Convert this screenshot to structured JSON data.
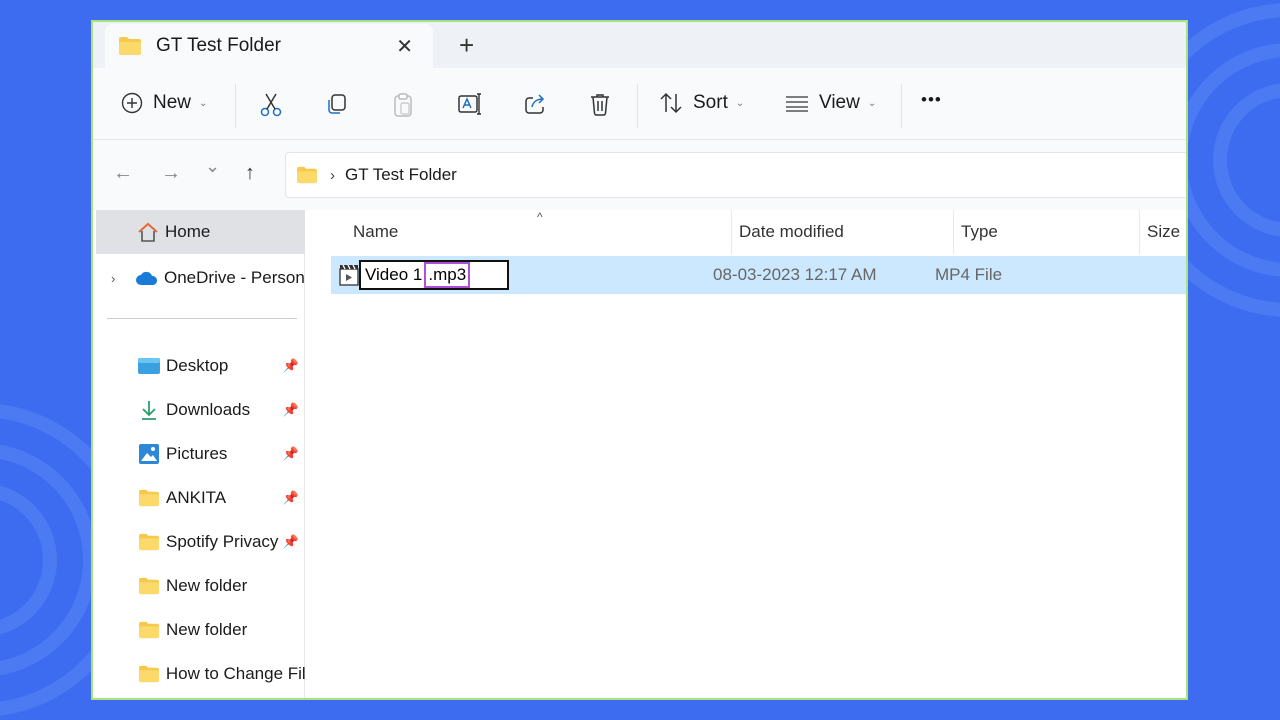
{
  "window": {
    "tab_title": "GT Test Folder",
    "tab_close": "✕",
    "new_tab": "+"
  },
  "toolbar": {
    "new_label": "New",
    "sort_label": "Sort",
    "view_label": "View",
    "more_label": "•••",
    "actions": [
      "cut-icon",
      "copy-icon",
      "paste-icon",
      "rename-icon",
      "share-icon",
      "delete-icon"
    ]
  },
  "nav": {
    "back": "←",
    "forward": "→",
    "recent": "⌄",
    "up": "↑",
    "breadcrumb_sep": "›",
    "breadcrumb": "GT Test Folder"
  },
  "sidebar": {
    "home": "Home",
    "onedrive": "OneDrive - Person",
    "items": [
      {
        "label": "Desktop",
        "icon": "desktop-icon",
        "pinned": true
      },
      {
        "label": "Downloads",
        "icon": "download-icon",
        "pinned": true
      },
      {
        "label": "Pictures",
        "icon": "pictures-icon",
        "pinned": true
      },
      {
        "label": "ANKITA",
        "icon": "folder-icon",
        "pinned": true
      },
      {
        "label": "Spotify Privacy :",
        "icon": "folder-icon",
        "pinned": true
      },
      {
        "label": "New folder",
        "icon": "folder-icon",
        "pinned": false
      },
      {
        "label": "New folder",
        "icon": "folder-icon",
        "pinned": false
      },
      {
        "label": "How to Change Fil",
        "icon": "folder-icon",
        "pinned": false
      }
    ]
  },
  "columns": {
    "name": "Name",
    "date_modified": "Date modified",
    "type": "Type",
    "size": "Size"
  },
  "files": [
    {
      "name_base": "Video 1",
      "name_ext": ".mp3",
      "date_modified": "08-03-2023 12:17 AM",
      "type": "MP4 File"
    }
  ],
  "colors": {
    "background": "#3d6cf0",
    "window_border": "#a8e27a",
    "selected_row": "#cce8ff",
    "extension_highlight": "#b050d8",
    "folder_yellow": "#f6c94e"
  }
}
